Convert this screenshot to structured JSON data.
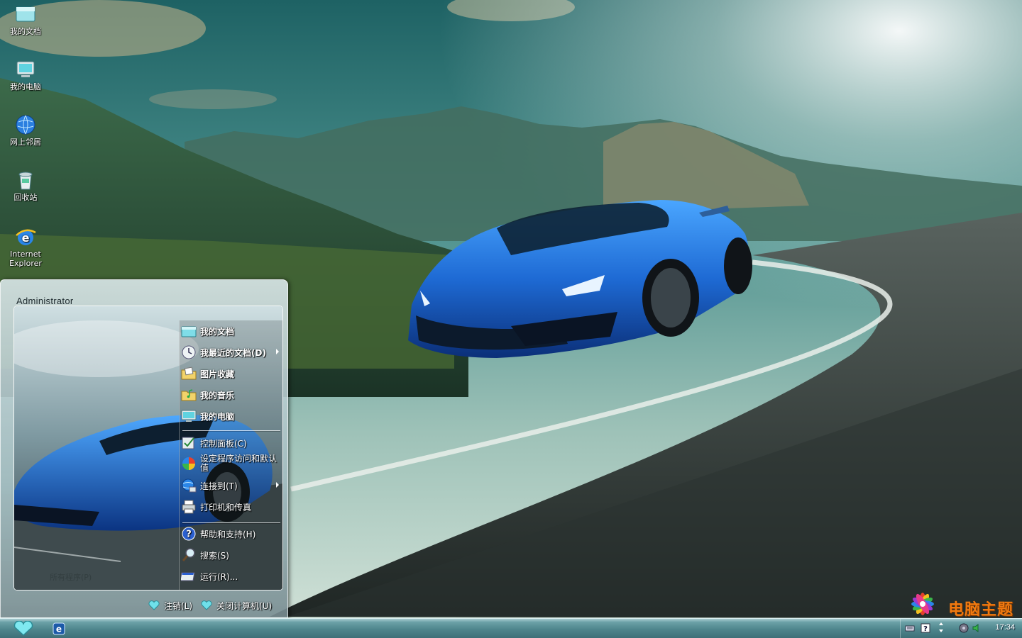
{
  "desktop": {
    "icons": [
      {
        "label": "我的文档",
        "icon": "my-documents-icon"
      },
      {
        "label": "我的电脑",
        "icon": "my-computer-icon"
      },
      {
        "label": "网上邻居",
        "icon": "network-places-icon"
      },
      {
        "label": "回收站",
        "icon": "recycle-bin-icon"
      },
      {
        "label": "Internet Explorer",
        "icon": "internet-explorer-icon"
      }
    ]
  },
  "start_menu": {
    "user_name": "Administrator",
    "left_hint": "所有程序(P)",
    "items": [
      {
        "label": "我的文档",
        "icon": "folder-docs-icon",
        "bold": true
      },
      {
        "label": "我最近的文档(D)",
        "icon": "recent-docs-icon",
        "bold": true,
        "submenu": true
      },
      {
        "label": "图片收藏",
        "icon": "pictures-folder-icon",
        "bold": true
      },
      {
        "label": "我的音乐",
        "icon": "music-folder-icon",
        "bold": true
      },
      {
        "label": "我的电脑",
        "icon": "computer-icon",
        "bold": true
      },
      {
        "label": "控制面板(C)",
        "icon": "control-panel-icon"
      },
      {
        "label": "设定程序访问和默认值",
        "icon": "program-defaults-icon"
      },
      {
        "label": "连接到(T)",
        "icon": "connect-to-icon",
        "submenu": true
      },
      {
        "label": "打印机和传真",
        "icon": "printer-icon"
      },
      {
        "label": "帮助和支持(H)",
        "icon": "help-icon"
      },
      {
        "label": "搜索(S)",
        "icon": "search-icon"
      },
      {
        "label": "运行(R)...",
        "icon": "run-icon"
      }
    ],
    "footer": {
      "logoff_label": "注销(L)",
      "shutdown_label": "关闭计算机(U)"
    }
  },
  "taskbar": {
    "clock": "17:34"
  },
  "watermark": {
    "text": "电脑主题"
  },
  "colors": {
    "car_blue": "#1f6fd6",
    "taskbar_teal": "#4e858c",
    "accent_cyan": "#5fd3e0"
  }
}
